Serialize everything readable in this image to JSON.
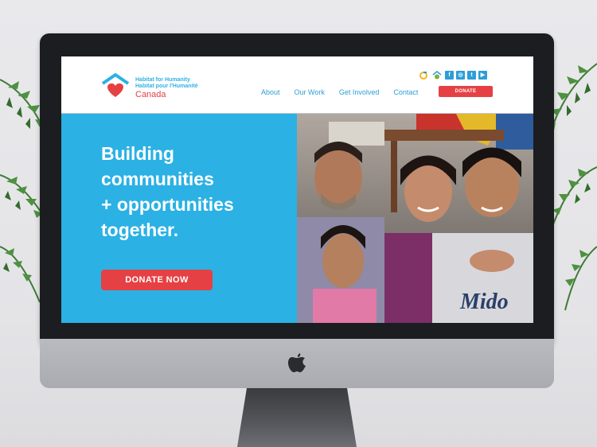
{
  "site": {
    "org_line1": "Habitat for Humanity",
    "org_line2": "Habitat pour l'Humanité",
    "org_country": "Canada"
  },
  "social_icons": [
    "habitat-restore-icon",
    "habitat-home-icon",
    "facebook-icon",
    "instagram-icon",
    "twitter-icon",
    "youtube-icon"
  ],
  "social_glyphs": {
    "facebook": "f",
    "instagram": "◎",
    "twitter": "t",
    "youtube": "▶"
  },
  "nav": {
    "items": [
      {
        "label": "About"
      },
      {
        "label": "Our Work"
      },
      {
        "label": "Get Involved"
      },
      {
        "label": "Contact"
      }
    ],
    "donate_label": "DONATE"
  },
  "hero": {
    "headline_lines": [
      "Building",
      "communities",
      "+ opportunities",
      "together."
    ],
    "cta_label": "DONATE NOW"
  },
  "colors": {
    "brand_blue": "#2bb1e4",
    "brand_red": "#e54145",
    "nav_blue": "#2c9ed7"
  }
}
